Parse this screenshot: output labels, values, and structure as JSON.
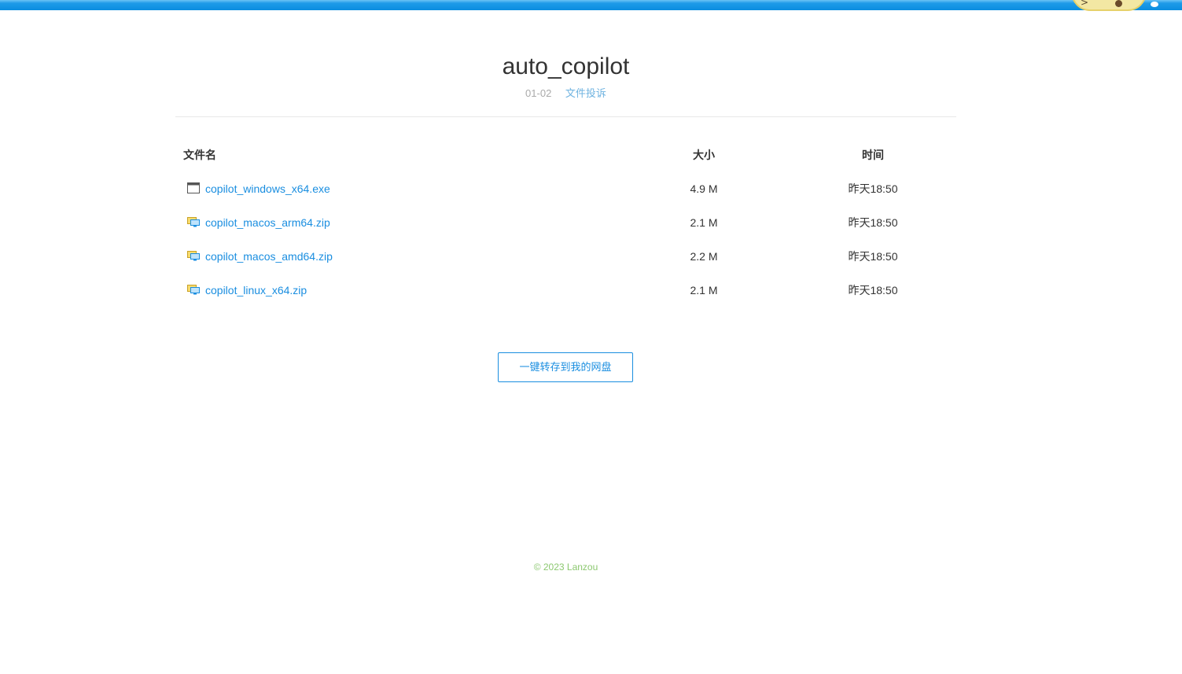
{
  "page": {
    "title": "auto_copilot",
    "date": "01-02",
    "report_link": "文件投诉"
  },
  "table": {
    "headers": {
      "name": "文件名",
      "size": "大小",
      "time": "时间"
    },
    "rows": [
      {
        "name": "copilot_windows_x64.exe",
        "size": "4.9 M",
        "time": "昨天18:50",
        "icon": "exe-file-icon"
      },
      {
        "name": "copilot_macos_arm64.zip",
        "size": "2.1 M",
        "time": "昨天18:50",
        "icon": "zip-file-icon"
      },
      {
        "name": "copilot_macos_amd64.zip",
        "size": "2.2 M",
        "time": "昨天18:50",
        "icon": "zip-file-icon"
      },
      {
        "name": "copilot_linux_x64.zip",
        "size": "2.1 M",
        "time": "昨天18:50",
        "icon": "zip-file-icon"
      }
    ]
  },
  "actions": {
    "save_to_disk": "一键转存到我的网盘"
  },
  "footer": {
    "copyright": "© 2023 Lanzou"
  },
  "colors": {
    "accent": "#1a8ee0",
    "top_bar": "#1e9be8",
    "footer_text": "#8cc870"
  }
}
